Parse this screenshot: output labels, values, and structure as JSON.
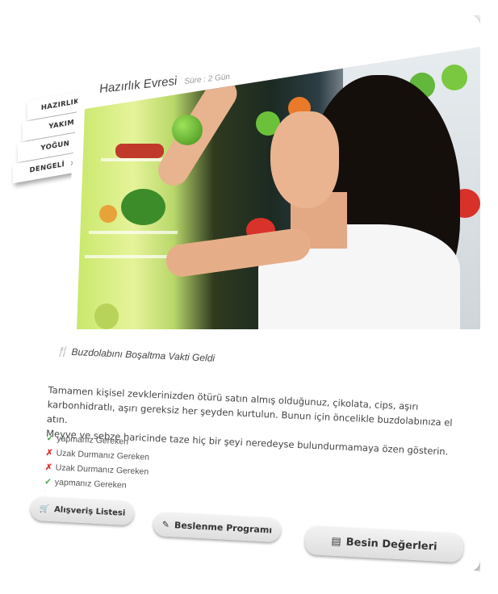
{
  "nav": {
    "items": [
      {
        "label": "HAZIRLIK"
      },
      {
        "label": "YAKIM"
      },
      {
        "label": "YOĞUN"
      },
      {
        "label": "DENGELİ"
      }
    ]
  },
  "header": {
    "title": "Hazırlık Evresi",
    "subtitle": "Süre : 2 Gün"
  },
  "content": {
    "heading": "Buzdolabını Boşaltma Vakti Geldi",
    "paragraph_lines": [
      "Tamamen kişisel zevklerinizden ötürü satın almış olduğunuz, çikolata, cips, aşırı",
      "karbonhidratlı, aşırı gereksiz her şeyden kurtulun. Bunun için öncelikle buzdolabınıza el atın.",
      "Meyve ve sebze haricinde taze hiç bir şeyi neredeyse bulundurmamaya özen gösterin."
    ],
    "checklist": [
      {
        "status": "ok",
        "label": "yapmanız Gereken"
      },
      {
        "status": "no",
        "label": "Uzak Durmanız Gereken"
      },
      {
        "status": "no",
        "label": "Uzak Durmanız Gereken"
      },
      {
        "status": "ok",
        "label": "yapmanız Gereken"
      }
    ]
  },
  "buttons": {
    "shopping": "Alışveriş Listesi",
    "program": "Beslenme Programı",
    "nutrition": "Besin Değerleri"
  },
  "icons": {
    "chevron": "chevron-right-icon",
    "fork_knife": "fork-knife-icon",
    "cart": "cart-icon",
    "pen": "pen-icon",
    "list": "list-icon",
    "check": "check-icon",
    "cross": "cross-icon"
  },
  "colors": {
    "ok": "#3fa34d",
    "no": "#e02a2a",
    "text": "#444444"
  }
}
